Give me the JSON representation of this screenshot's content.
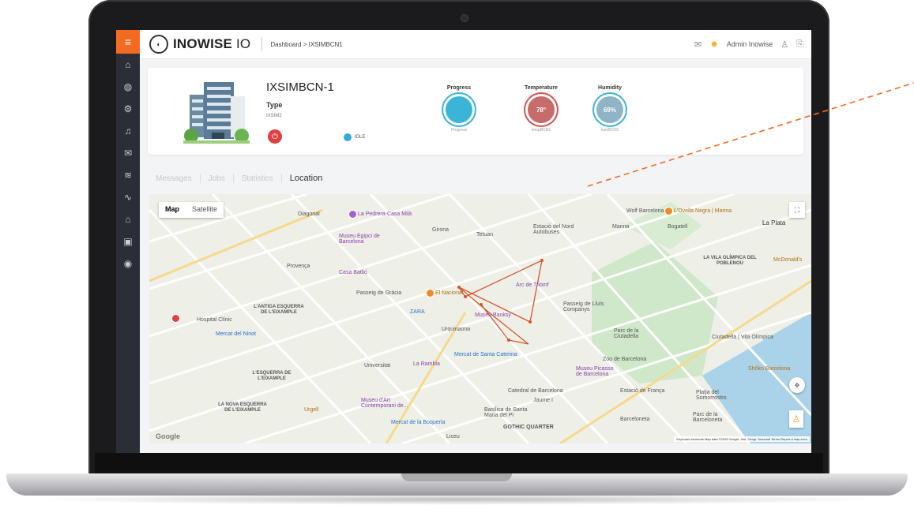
{
  "app": {
    "logo_text": "INOWISE",
    "logo_suffix": " IO",
    "breadcrumb": "Dashboard > IXSIMBCN1",
    "user": "Admin Inowise"
  },
  "device": {
    "name": "IXSIMBCN-1",
    "type_label": "Type",
    "type_value": "IXSIM2",
    "status": "IDLE",
    "gauges": [
      {
        "title": "Progress",
        "value": "",
        "caption": "Progress",
        "color": "#3ab5d8"
      },
      {
        "title": "Temperature",
        "value": "78°",
        "caption": "tempBCN1",
        "color": "#c76b6b"
      },
      {
        "title": "Humidity",
        "value": "69%",
        "caption": "humBCN1",
        "color": "#8fb3c7"
      }
    ]
  },
  "tabs": [
    "Messages",
    "Jobs",
    "Statistics",
    "Location"
  ],
  "active_tab": "Location",
  "map": {
    "type_map": "Map",
    "type_satellite": "Satellite",
    "google": "Google",
    "attribution": "Keyboard shortcuts   Map data ©2025 Google, Inst. Geogr. Nacional   Terms   Report a map error",
    "labels": {
      "diagonal": "Diagonal",
      "pedrera": "La Pedrera-Casa Milà",
      "girona": "Girona",
      "tetuan": "Tetuan",
      "estacio_nord": "Estació del Nord Autobuses",
      "wolf": "Wolf Barcelona",
      "ovella": "L'Ovella Negra | Marina",
      "la_plata": "La Plata",
      "marina": "Marina",
      "bogatell": "Bogatell",
      "museu_egipci": "Museu Egipci de Barcelona",
      "provenca": "Provença",
      "casa_batllo": "Casa Batlló",
      "passeig_gracia": "Passeig de Gràcia",
      "el_nacional": "El Nacional",
      "arc_triomf": "Arc de Triomf",
      "vila_olimpica": "LA VILA OLÍMPICA DEL POBLENOU",
      "mcdonalds": "McDonald's",
      "antiga": "L'ANTIGA ESQUERRA DE L'EIXAMPLE",
      "zara": "ZARA",
      "museu_banksy": "Museu Banksy",
      "passeig_lluis": "Passeig de Lluís Companys",
      "hospital": "Hospital Clínic",
      "mercat_ninot": "Mercat del Ninot",
      "urquinaona": "Urquinaona",
      "parc_ciutadella": "Parc de la Ciutadella",
      "ciutadella_vo": "Ciutadella | Vila Olímpica",
      "mercat_caterina": "Mercat de Santa Caterina",
      "zoo": "Zoo de Barcelona",
      "universitat": "Universitat",
      "la_rambla": "La Rambla",
      "museu_picasso": "Museu Picasso de Barcelona",
      "shoko": "Shôko Barcelona",
      "esquerra": "L'ESQUERRA DE L'EIXAMPLE",
      "catedral": "Catedral de Barcelona",
      "jaume": "Jaume I",
      "estacio_franca": "Estació de França",
      "platja": "Platja del Somorrostro",
      "nova_esquerra": "LA NOVA ESQUERRA DE L'EIXAMPLE",
      "urgell": "Urgell",
      "macba": "Museu d'Art Contemporani de...",
      "basilica": "Basílica de Santa Maria del Pi",
      "gothic": "GOTHIC QUARTER",
      "mercat_boqueria": "Mercat de la Boqueria",
      "barceloneta": "Barceloneta",
      "parc_barceloneta": "Parc de la Barceloneta",
      "liceu": "Liceu"
    }
  }
}
